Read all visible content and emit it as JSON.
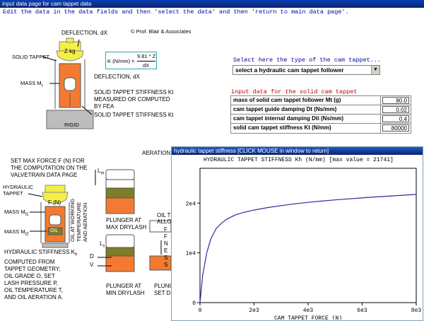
{
  "window_title": "input data page for cam tappet data",
  "instructions": "Edit the data in the data fields and then 'select the data' and then 'return to main data page'.",
  "solid_diagram": {
    "deflection_top": "DEFLECTION, dX",
    "copyright": "© Prof. Blair & Associates",
    "solid_tappet": "SOLID TAPPET",
    "z_kg": "Z kg",
    "mass": "MASS M",
    "mass_sub": "t",
    "rigid": "RIGID",
    "formula_lhs": "K (N/mm) =",
    "formula_num": "9.81 * Z",
    "formula_den": "dX",
    "deflection_bottom": "DEFLECTION, dX",
    "stiffness_text": [
      "SOLID TAPPET STIFFNESS Kt",
      "MEASURED OR COMPUTED",
      "BY FEA"
    ],
    "stiffness_arrow_label": "SOLID TAPPET STIFFNESS Kt"
  },
  "selector": {
    "title": "Select here the type of the cam tappet...",
    "value": "select a hydraulic cam tappet follower"
  },
  "form": {
    "title": "input data for the solid cam tappet",
    "rows": [
      {
        "label": "mass of solid cam tappet follower Mt (g)",
        "value": "80.0"
      },
      {
        "label": "cam tappet guide damping Dt (Ns/mm)",
        "value": "0.02"
      },
      {
        "label": "cam tappet internal damping Dti (Ns/mm)",
        "value": "0.4"
      },
      {
        "label": "solid cam tappet stiffness Kt (N/mm)",
        "value": "80000"
      }
    ]
  },
  "hydraulic_diagram": {
    "set_max": [
      "SET MAX FORCE F (N) FOR",
      "THE COMPUTATION ON THE",
      "VALVETRAIN DATA PAGE"
    ],
    "hydraulic_tappet": [
      "HYDRAULIC",
      "TAPPET"
    ],
    "f_n": "F (N)",
    "mass_t1": "MASS M",
    "mass_t1_sub": "t1",
    "mass_t2": "MASS M",
    "mass_t2_sub": "t2",
    "oil": "OIL",
    "oil_working": [
      "OIL AT WORKING",
      "TEMPERATURE",
      "AND AERATION"
    ],
    "stiffness_text": [
      "HYDRAULIC STIFFNESS K",
      "COMPUTED FROM",
      "TAPPET GEOMETRY,",
      "OIL GRADE O, SET",
      "LASH PRESSURE P,",
      "OIL TEMPERATURE T,",
      "AND OIL AERATION A."
    ],
    "stiffness_sub": "h",
    "aeration": "AERATION",
    "lm": "L",
    "lm_sub": "m",
    "ls": "L",
    "ls_sub": "s",
    "d": "D",
    "v": "V",
    "plunger_max": [
      "PLUNGER AT",
      "MAX DRYLASH"
    ],
    "plunger_min": [
      "PLUNGER AT",
      "MIN DRYLASH"
    ],
    "oil_t": [
      "OIL T",
      "ALLO"
    ],
    "letters": [
      "F",
      "F",
      "N",
      "E",
      "S",
      "S"
    ],
    "plung_partial": [
      "PLUNG",
      "SET D"
    ]
  },
  "chart_window": {
    "title": "hydraulic tappet stiffness [CLICK MOUSE in window to return]"
  },
  "chart_data": {
    "type": "line",
    "title": "HYDRAULIC TAPPET STIFFNESS Kh (N/mm)",
    "max_label": "[max value = 21741]",
    "xlabel": "CAM TAPPET FORCE (N)",
    "ylabel": "",
    "xlim": [
      0,
      8000
    ],
    "ylim": [
      0,
      27000
    ],
    "x_ticks": [
      {
        "v": 0,
        "label": "0"
      },
      {
        "v": 2000,
        "label": "2e3"
      },
      {
        "v": 4000,
        "label": "4e3"
      },
      {
        "v": 6000,
        "label": "6e3"
      },
      {
        "v": 8000,
        "label": "8e3"
      }
    ],
    "y_ticks": [
      {
        "v": 0,
        "label": "0"
      },
      {
        "v": 10000,
        "label": "1e4"
      },
      {
        "v": 20000,
        "label": "2e4"
      }
    ],
    "x": [
      0,
      100,
      250,
      400,
      600,
      800,
      1000,
      1300,
      1600,
      2000,
      2500,
      3000,
      3500,
      4000,
      4500,
      5000,
      5500,
      6000,
      6500,
      7000,
      7500,
      8000
    ],
    "y": [
      0,
      5500,
      10000,
      12800,
      14900,
      16000,
      16800,
      17600,
      18100,
      18600,
      19100,
      19500,
      19850,
      20150,
      20400,
      20650,
      20850,
      21050,
      21250,
      21400,
      21580,
      21741
    ],
    "line_color": "#2b2b9e"
  }
}
